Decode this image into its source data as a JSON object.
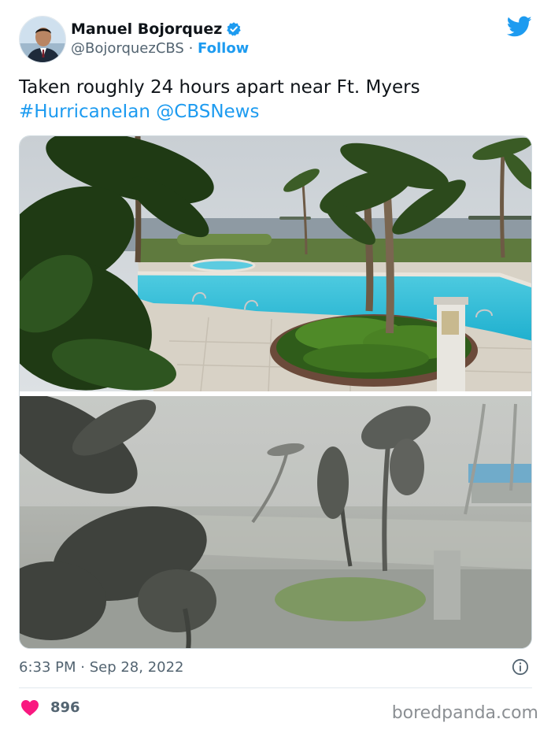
{
  "author": {
    "name": "Manuel Bojorquez",
    "handle": "@BojorquezCBS",
    "separator": "·",
    "follow_label": "Follow"
  },
  "tweet": {
    "text_line1": "Taken roughly 24 hours apart near Ft. Myers",
    "hashtag": "#HurricaneIan",
    "mention": "@CBSNews",
    "timestamp": "6:33 PM · Sep 28, 2022",
    "likes": "896"
  },
  "watermark": "boredpanda.com",
  "icons": {
    "verified": "verified-badge-icon",
    "platform": "twitter-bird-icon",
    "info": "info-icon",
    "like": "heart-icon"
  },
  "colors": {
    "accent": "#1d9bf0",
    "text": "#0f1419",
    "muted": "#536471",
    "heart": "#f91880"
  }
}
